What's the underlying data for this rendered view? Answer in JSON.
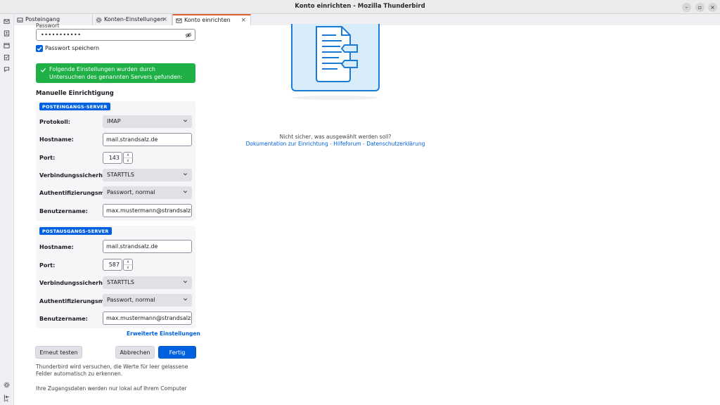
{
  "window": {
    "title": "Konto einrichten - Mozilla Thunderbird"
  },
  "tabs": [
    {
      "label": "Posteingang",
      "icon": "inbox-icon"
    },
    {
      "label": "Konten-Einstellungen",
      "icon": "gear-icon"
    },
    {
      "label": "Konto einrichten",
      "icon": "account-icon",
      "active": true
    }
  ],
  "password": {
    "label": "Passwort",
    "value": "•••••••••••",
    "remember_label": "Passwort speichern",
    "remember_checked": true
  },
  "success_message": "Folgende Einstellungen wurden durch Untersuchen des genannten Servers gefunden:",
  "manual_title": "Manuelle Einrichtigung",
  "incoming": {
    "badge": "POSTEINGANGS-SERVER",
    "protocol_label": "Protokoll:",
    "protocol_value": "IMAP",
    "hostname_label": "Hostname:",
    "hostname_value": "mail.strandsalz.de",
    "port_label": "Port:",
    "port_value": "143",
    "security_label": "Verbindungssicherheit:",
    "security_value": "STARTTLS",
    "auth_label": "Authentifizierungsmethode:",
    "auth_value": "Passwort, normal",
    "username_label": "Benutzername:",
    "username_value": "max.mustermann@strandsalz.de"
  },
  "outgoing": {
    "badge": "POSTAUSGANGS-SERVER",
    "hostname_label": "Hostname:",
    "hostname_value": "mail.strandsalz.de",
    "port_label": "Port:",
    "port_value": "587",
    "security_label": "Verbindungssicherheit:",
    "security_value": "STARTTLS",
    "auth_label": "Authentifizierungsmethode:",
    "auth_value": "Passwort, normal",
    "username_label": "Benutzername:",
    "username_value": "max.mustermann@strandsalz.de"
  },
  "advanced_link": "Erweiterte Einstellungen",
  "buttons": {
    "retest": "Erneut testen",
    "cancel": "Abbrechen",
    "done": "Fertig"
  },
  "notes": {
    "autofill": "Thunderbird wird versuchen, die Werte für leer gelassene Felder automatisch zu erkennen.",
    "local": "Ihre Zugangsdaten werden nur lokal auf Ihrem Computer"
  },
  "help": {
    "question": "Nicht sicher, was ausgewählt werden soll?",
    "link_docs": "Dokumentation zur Einrichtung",
    "link_forum": "Hilfeforum",
    "link_privacy": "Datenschutzerklärung",
    "separator": " - "
  },
  "colors": {
    "accent": "#0061e0",
    "success": "#1fb148",
    "tab_highlight": "#e06030"
  }
}
